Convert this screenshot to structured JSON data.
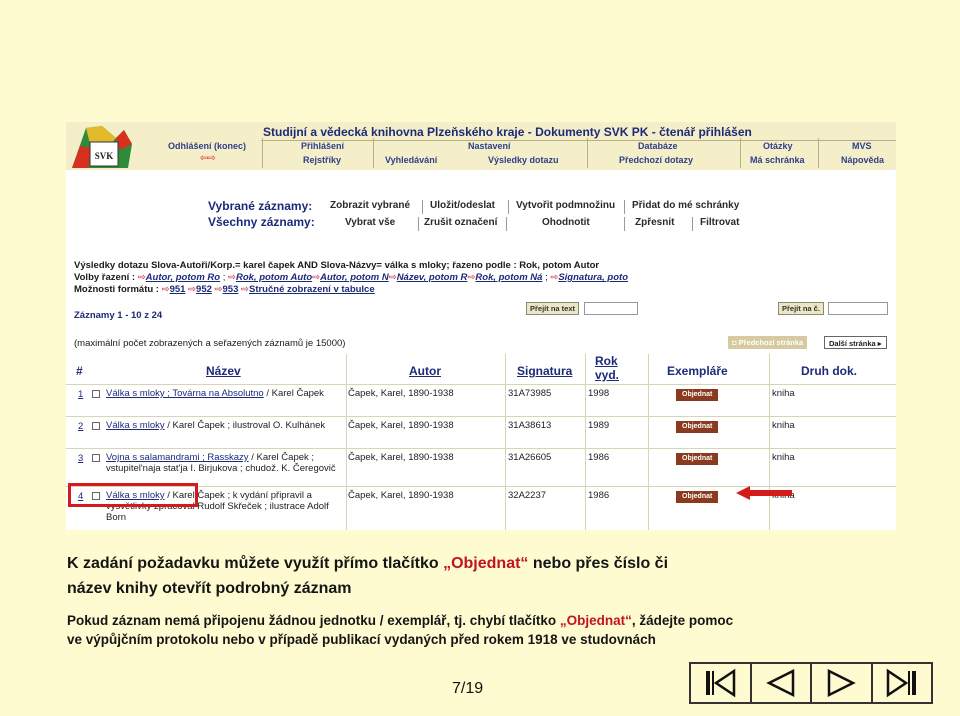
{
  "app": {
    "title": "Studijní a vědecká knihovna Plzeňského kraje - Dokumenty SVK PK - čtenář přihlášen",
    "logo_text": "SVK",
    "nav_row1": [
      "Odhlášení (konec)",
      "Přihlášení",
      "Nastavení",
      "Databáze",
      "Otázky",
      "MVS"
    ],
    "nav_row2": [
      "Rejstříky",
      "Vyhledávání",
      "Výsledky dotazu",
      "Předchozí dotazy",
      "Má schránka",
      "Nápověda"
    ],
    "accent": "#1c2a78",
    "header_bg": "#f4efc8"
  },
  "actions": {
    "selected_label": "Vybrané záznamy:",
    "all_label": "Všechny záznamy:",
    "row1": [
      "Zobrazit vybrané",
      "Uložit/odeslat",
      "Vytvořit podmnožinu",
      "Přidat do mé schránky"
    ],
    "row2": [
      "Vybrat vše",
      "Zrušit označení",
      "Ohodnotit",
      "Zpřesnit",
      "Filtrovat"
    ]
  },
  "query": {
    "line1": "Výsledky dotazu Slova-Autoři/Korp.= karel čapek AND Slova-Názvy= válka s mloky; řazeno podle : Rok, potom Autor",
    "sort_label": "Volby řazení :",
    "sort_options": [
      "Autor, potom Ro",
      "Rok, potom Auto",
      "Autor, potom N",
      "Název, potom R",
      "Rok, potom Ná",
      "Signatura, poto"
    ],
    "format_label": "Možnosti formátu :",
    "formats": [
      "951",
      "952",
      "953",
      "Stručné zobrazení v tabulce"
    ],
    "records": "Záznamy 1 - 10 z 24",
    "goto_record_btn": "Přejít na text",
    "goto_page_btn": "Přejít na č.",
    "max_note": "(maximální počet zobrazených a seřazených záznamů je 15000)",
    "prev_page": "Předchozí stránka",
    "next_page": "Další stránka"
  },
  "table": {
    "headers": {
      "num": "#",
      "title": "Název",
      "author": "Autor",
      "sig": "Signatura",
      "year1": "Rok",
      "year2": "vyd.",
      "copies": "Exempláře",
      "type": "Druh dok."
    },
    "order_button": "Objednat",
    "rows": [
      {
        "num": "1",
        "title_link": "Válka s mloky ; Továrna na Absolutno",
        "title_rest": " / Karel Čapek",
        "author": "Čapek, Karel, 1890-1938",
        "sig": "31A73985",
        "year": "1998",
        "type": "kniha"
      },
      {
        "num": "2",
        "title_link": "Válka s mloky",
        "title_rest": " / Karel Čapek ; ilustroval O. Kulhánek",
        "author": "Čapek, Karel, 1890-1938",
        "sig": "31A38613",
        "year": "1989",
        "type": "kniha"
      },
      {
        "num": "3",
        "title_link": "Vojna s salamandrami ; Rasskazy",
        "title_rest": " / Karel Čapek ; vstupitel'naja stat'ja I. Birjukova ; chudož. K. Čeregovič",
        "author": "Čapek, Karel, 1890-1938",
        "sig": "31A26605",
        "year": "1986",
        "type": "kniha"
      },
      {
        "num": "4",
        "title_link": "Válka s mloky",
        "title_rest": " / Karel Čapek ; k vydání připravil a vysvětlivky zpracoval Rudolf Skřeček ; ilustrace Adolf Born",
        "author": "Čapek, Karel, 1890-1938",
        "sig": "32A2237",
        "year": "1986",
        "type": "kniha"
      }
    ]
  },
  "slide": {
    "heading1_a": "K zadání požadavku můžete využít přímo tlačítko ",
    "heading1_q": "„Objednat“",
    "heading1_b": " nebo přes číslo či",
    "heading2": "název knihy otevřít podrobný záznam",
    "body1_a": "Pokud záznam nemá připojenu žádnou jednotku / exemplář, tj. chybí tlačítko ",
    "body1_q": "„Objednat“",
    "body1_b": ", žádejte pomoc",
    "body2": "ve výpůjčním protokolu nebo v případě publikací vydaných před rokem 1918 ve studovnách",
    "page": "7/19",
    "highlight_color": "#c0141e"
  }
}
